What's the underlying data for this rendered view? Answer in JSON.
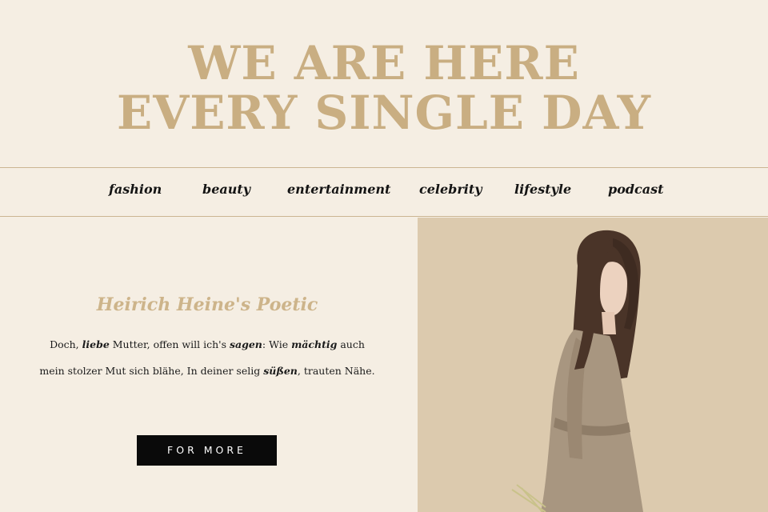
{
  "hero": {
    "line1": "WE ARE HERE",
    "line2": "EVERY SINGLE DAY"
  },
  "nav": {
    "items": [
      {
        "label": "fashion"
      },
      {
        "label": "beauty"
      },
      {
        "label": "entertainment"
      },
      {
        "label": "celebrity"
      },
      {
        "label": "lifestyle"
      },
      {
        "label": "podcast"
      }
    ]
  },
  "article": {
    "title": "Heirich Heine's Poetic",
    "text": [
      {
        "t": "Doch, ",
        "em": false
      },
      {
        "t": "liebe",
        "em": true
      },
      {
        "t": " Mutter, offen will ich's ",
        "em": false
      },
      {
        "t": "sagen",
        "em": true
      },
      {
        "t": ": Wie ",
        "em": false
      },
      {
        "t": "mächtig",
        "em": true
      },
      {
        "t": " auch mein stolzer Mut sich blähe, In deiner selig ",
        "em": false
      },
      {
        "t": "süßen",
        "em": true
      },
      {
        "t": ", trauten Nähe.",
        "em": false
      }
    ],
    "button_label": "FOR MORE"
  },
  "photo": {
    "icon": "woman-portrait-photo",
    "colors": {
      "backdrop": "#dccaae",
      "hair": "#4a3428",
      "skin": "#ecd2bf",
      "dress": "#a89680"
    }
  },
  "colors": {
    "background": "#f5eee3",
    "accent": "#c9ae82",
    "divider": "#cbb592",
    "button": "#0a0a0a"
  }
}
